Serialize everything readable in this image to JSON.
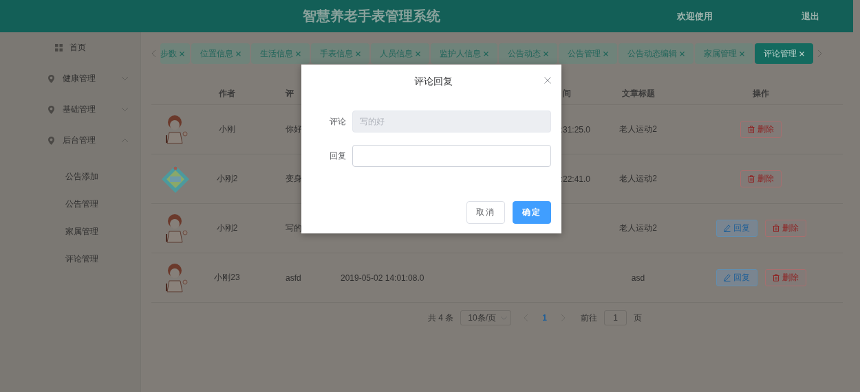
{
  "header": {
    "title": "智慧养老手表管理系统",
    "welcome": "欢迎使用",
    "logout": "退出"
  },
  "sidebar": {
    "home": "首页",
    "groups": [
      {
        "label": "健康管理",
        "expanded": false
      },
      {
        "label": "基础管理",
        "expanded": false
      },
      {
        "label": "后台管理",
        "expanded": true,
        "children": [
          {
            "label": "公告添加"
          },
          {
            "label": "公告管理"
          },
          {
            "label": "家属管理"
          },
          {
            "label": "评论管理"
          }
        ]
      }
    ]
  },
  "tabs": [
    {
      "label": "步数",
      "selected": false
    },
    {
      "label": "位置信息",
      "selected": false
    },
    {
      "label": "生活信息",
      "selected": false
    },
    {
      "label": "手表信息",
      "selected": false
    },
    {
      "label": "人员信息",
      "selected": false
    },
    {
      "label": "监护人信息",
      "selected": false
    },
    {
      "label": "公告动态",
      "selected": false
    },
    {
      "label": "公告管理",
      "selected": false
    },
    {
      "label": "公告动态编辑",
      "selected": false
    },
    {
      "label": "家属管理",
      "selected": false
    },
    {
      "label": "评论管理",
      "selected": true
    }
  ],
  "table": {
    "columns": [
      "作者",
      "评",
      "间",
      "文章标题",
      "操作"
    ],
    "rows": [
      {
        "author": "小刚",
        "comment": "你好",
        "time": ":31:25.0",
        "time_cut": true,
        "title": "老人运动2",
        "actions": [
          {
            "kind": "delete",
            "label": "删除"
          }
        ]
      },
      {
        "author": "小刚2",
        "comment": "变身",
        "time": ":22:41.0",
        "time_cut": true,
        "title": "老人运动2",
        "actions": [
          {
            "kind": "delete",
            "label": "删除"
          }
        ]
      },
      {
        "author": "小刚2",
        "comment": "写的",
        "title": "老人运动2",
        "actions": [
          {
            "kind": "reply",
            "label": "回复"
          },
          {
            "kind": "delete",
            "label": "删除"
          }
        ]
      },
      {
        "author": "小刚23",
        "comment": "asfd",
        "time": "2019-05-02 14:01:08.0",
        "time_cut": false,
        "title": "asd",
        "actions": [
          {
            "kind": "reply",
            "label": "回复"
          },
          {
            "kind": "delete",
            "label": "删除"
          }
        ]
      }
    ]
  },
  "pagination": {
    "total": "共 4 条",
    "page_size": "10条/页",
    "pages": [
      {
        "label": "1",
        "selected": true
      }
    ],
    "goto_label": "前往",
    "goto_value": "1",
    "page_unit": "页"
  },
  "dialog": {
    "title": "评论回复",
    "fields": [
      {
        "label": "评论",
        "value": "写的好",
        "disabled": true
      },
      {
        "label": "回复",
        "disabled": false
      }
    ],
    "cancel": "取消",
    "confirm": "确定"
  }
}
